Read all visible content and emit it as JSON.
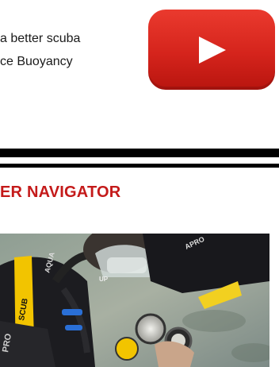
{
  "intro": {
    "line1": "a better scuba",
    "line2": "ce Buoyancy"
  },
  "video": {
    "icon": "youtube-play-icon",
    "color": "#e52d27"
  },
  "section": {
    "heading": "ER NAVIGATOR"
  },
  "photo": {
    "labels": {
      "bcd_brand": "SCUB",
      "hose_brand": "AQUA",
      "chest_brand": "PRO",
      "sleeve_brand": "APRO",
      "gauge_brand": "UP"
    }
  }
}
